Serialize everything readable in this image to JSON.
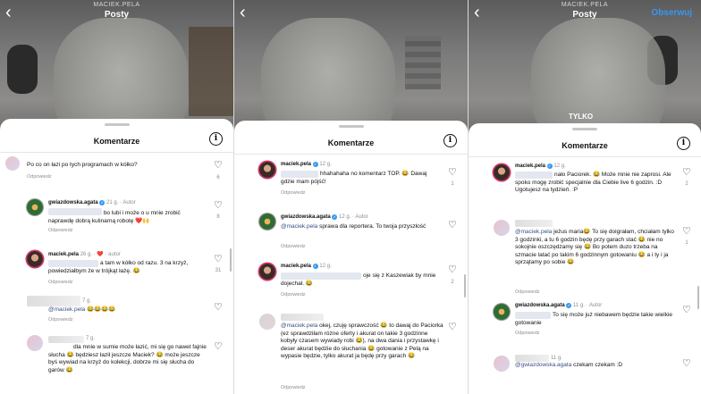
{
  "common": {
    "username_top": "MACIEK.PELA",
    "posts_title": "Posty",
    "follow_label": "Obserwuj",
    "comments_title": "Komentarze",
    "reply_label": "Odpowiedz",
    "info_glyph": "i",
    "back_glyph": "‹",
    "heart_glyph": "♡"
  },
  "panel3_overlay": "TYLKO",
  "panel1": {
    "comments": [
      {
        "meta": "",
        "text": "Po co on łazi po tych programach w kółko?",
        "likes": "6"
      },
      {
        "user": "gwiazdowska.agata",
        "meta": "21 g. · Autor",
        "text_pre": "",
        "text": "bo lubi i może o u mnie zrobić naprawdę dobrą kulinarną robotę ❤️🙌",
        "likes": "8"
      },
      {
        "user": "maciek.pela",
        "meta": "26 g. · ❤️ · autor",
        "text": "a tam w kółko od razu. 3 na krzyż, powiedziałbym że w trójkąt łażę. 😂",
        "likes": "31"
      },
      {
        "meta": "7 g.",
        "mention": "@maciek.pela",
        "text": "😂😂😂😂",
        "likes": ""
      },
      {
        "meta": "7 g.",
        "text": "dla mnie w sumie może łazić, mi się go nawet fajnie słucha 😂 będziesz łaził jeszcze Maciek? 😂 może jeszcze byś wywiad na krzyż do kolekcji, dobrze mi się słucha do garów 😂",
        "likes": ""
      }
    ]
  },
  "panel2": {
    "comments": [
      {
        "user": "maciek.pela",
        "meta": "12 g.",
        "text": "hhahahaha no komentarz TOP. 😂 Dawaj gdzie mam pójść!",
        "likes": "1"
      },
      {
        "user": "gwiazdowska.agata",
        "meta": "12 g. · Autor",
        "mention": "@maciek.pela",
        "text": "sprawa dla reportera. To twoja przyszłość",
        "likes": ""
      },
      {
        "user": "maciek.pela",
        "meta": "12 g.",
        "text": "oje się z Kaszewiak by mnie dojechał. 😂",
        "likes": "2"
      },
      {
        "meta": "",
        "mention": "@maciek.pela",
        "text": "okej, czuję sprawczość 😂 to dawaj do Paciorka (ez sprawdziłam różne oferty i akurat on takie 3 godzinne kobyły czasem wywiady robi 😂), na dwa dania i przystawkę i deser akurat będzie do słuchania 😂 gotowanie z Pelą na wypasie będzie, tylko akurat ja będę przy garach 😂",
        "likes": ""
      }
    ]
  },
  "panel3": {
    "comments": [
      {
        "user": "maciek.pela",
        "meta": "12 g.",
        "text": "Może mnie nie zaprosi. Ale spoko mogę zrobić specjalnie dla Ciebie live 6 godzin. :D Ugotujesz na tydzień. :P",
        "text_pre": "nało Paciorek. 😂",
        "likes": "2"
      },
      {
        "meta": "",
        "mention": "@maciek.pela",
        "text": "jeżus maria😂 To się doigrałam, chciałam tylko 3 godzinki, a tu 6 godzin będę przy garach stać 😂 nie no sokojnie oszczędzamy się 😂 Bo potem duzo trzeba na szmacie latać po takim 6 godzinnym gotowaniu 😂 a i ty i ja sprzątamy po sobie 😂",
        "likes": "1"
      },
      {
        "user": "gwiazdowska.agata",
        "meta": "11 g. · Autor",
        "text": "To się może już niebawem będzie takie wielkie gotowanie",
        "likes": ""
      },
      {
        "meta": "11 g.",
        "mention": "@gwiazdowska.agata",
        "text": "czekam czekam :D",
        "likes": ""
      }
    ]
  }
}
